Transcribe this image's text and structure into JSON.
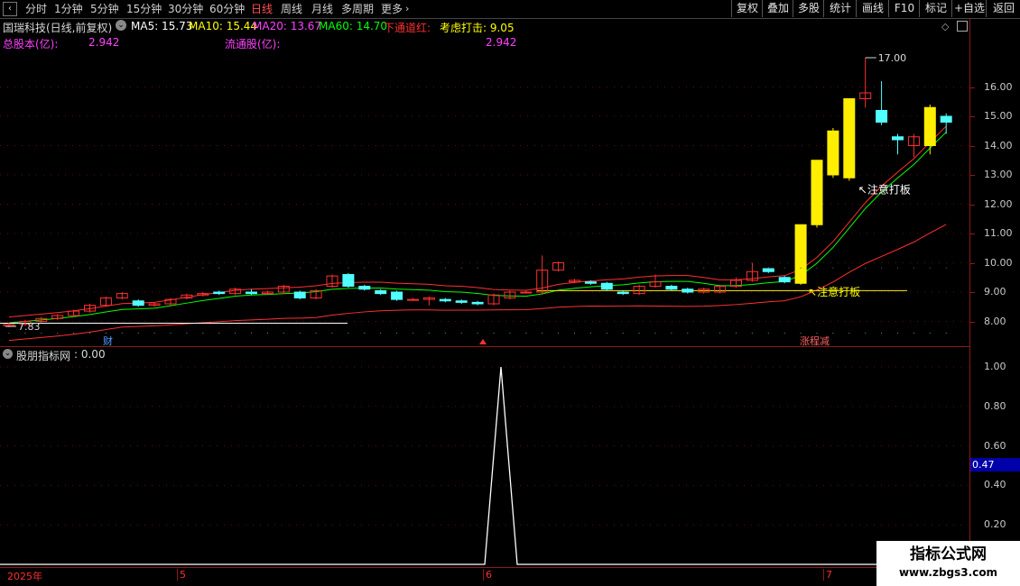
{
  "toolbar": {
    "back_icon": "chevron-left-icon",
    "periods": [
      "分时",
      "1分钟",
      "5分钟",
      "15分钟",
      "30分钟",
      "60分钟",
      "日线",
      "周线",
      "月线",
      "多周期",
      "更多"
    ],
    "active_period": "日线",
    "more_icon": "chevron-right-icon",
    "buttons": [
      "复权",
      "叠加",
      "多股",
      "统计",
      "画线",
      "F10",
      "标记",
      "+自选",
      "返回"
    ]
  },
  "header": {
    "stock": "国瑞科技(日线,前复权)",
    "ma5": "MA5: 15.73",
    "ma10": "MA10: 15.44",
    "ma20": "MA20: 13.67",
    "ma60": "MA60: 14.70",
    "signal1": "下通道红:",
    "signal2": "考虑打击: 9.05",
    "total_shares_label": "总股本(亿):",
    "total_shares": "2.942",
    "float_shares_label": "流通股(亿):",
    "float_shares": "2.942"
  },
  "chart_data": {
    "type": "candlestick",
    "y_ticks": [
      "16.00",
      "15.00",
      "14.00",
      "13.00",
      "12.00",
      "11.00",
      "10.00",
      "9.00",
      "8.00"
    ],
    "ylim": [
      7.4,
      17.4
    ],
    "high_label": "17.00",
    "low_label": "7.83",
    "annotations": [
      "注意打板",
      "注意打板"
    ],
    "markers": [
      "财",
      "涨程减"
    ],
    "hline": 9.05,
    "candles": [
      [
        7.85,
        7.9,
        7.8,
        7.95
      ],
      [
        7.9,
        8.0,
        7.85,
        8.05
      ],
      [
        8.0,
        8.1,
        7.95,
        8.15
      ],
      [
        8.1,
        8.2,
        8.05,
        8.25
      ],
      [
        8.2,
        8.35,
        8.15,
        8.4
      ],
      [
        8.35,
        8.55,
        8.3,
        8.6
      ],
      [
        8.55,
        8.8,
        8.5,
        8.85
      ],
      [
        8.8,
        8.95,
        8.75,
        9.0
      ],
      [
        8.7,
        8.55,
        8.5,
        8.75
      ],
      [
        8.55,
        8.6,
        8.5,
        8.65
      ],
      [
        8.6,
        8.75,
        8.55,
        8.8
      ],
      [
        8.8,
        8.9,
        8.75,
        8.95
      ],
      [
        8.9,
        8.95,
        8.85,
        9.0
      ],
      [
        9.0,
        8.95,
        8.9,
        9.05
      ],
      [
        8.95,
        9.1,
        8.9,
        9.15
      ],
      [
        9.0,
        8.95,
        8.9,
        9.1
      ],
      [
        8.95,
        9.0,
        8.9,
        9.05
      ],
      [
        9.0,
        9.2,
        8.95,
        9.25
      ],
      [
        9.0,
        8.8,
        8.75,
        9.05
      ],
      [
        8.8,
        9.05,
        8.75,
        9.1
      ],
      [
        9.2,
        9.55,
        9.15,
        9.6
      ],
      [
        9.6,
        9.2,
        9.15,
        9.65
      ],
      [
        9.2,
        9.1,
        9.05,
        9.25
      ],
      [
        9.05,
        8.95,
        8.9,
        9.1
      ],
      [
        9.0,
        8.75,
        8.7,
        9.05
      ],
      [
        8.75,
        8.75,
        8.7,
        8.8
      ],
      [
        8.75,
        8.8,
        8.55,
        8.85
      ],
      [
        8.75,
        8.7,
        8.65,
        8.8
      ],
      [
        8.7,
        8.65,
        8.6,
        8.75
      ],
      [
        8.65,
        8.6,
        8.55,
        8.7
      ],
      [
        8.6,
        8.9,
        8.55,
        8.95
      ],
      [
        8.8,
        9.0,
        8.75,
        9.05
      ],
      [
        9.0,
        9.0,
        8.95,
        9.05
      ],
      [
        9.0,
        9.75,
        8.95,
        10.25
      ],
      [
        9.75,
        10.0,
        9.7,
        10.05
      ],
      [
        9.35,
        9.4,
        9.3,
        9.45
      ],
      [
        9.35,
        9.3,
        9.25,
        9.4
      ],
      [
        9.3,
        9.1,
        9.05,
        9.35
      ],
      [
        9.0,
        8.95,
        8.9,
        9.05
      ],
      [
        8.95,
        9.2,
        8.9,
        9.25
      ],
      [
        9.2,
        9.35,
        9.15,
        9.6
      ],
      [
        9.2,
        9.1,
        9.05,
        9.25
      ],
      [
        9.1,
        9.0,
        8.95,
        9.15
      ],
      [
        9.0,
        9.1,
        8.95,
        9.15
      ],
      [
        9.0,
        9.2,
        8.95,
        9.25
      ],
      [
        9.2,
        9.4,
        9.15,
        9.5
      ],
      [
        9.4,
        9.7,
        9.35,
        10.0
      ],
      [
        9.8,
        9.7,
        9.65,
        9.85
      ],
      [
        9.5,
        9.35,
        9.3,
        9.55
      ],
      [
        9.3,
        11.3,
        9.25,
        11.3
      ],
      [
        11.3,
        13.5,
        11.2,
        13.5
      ],
      [
        13.0,
        14.5,
        12.9,
        14.6
      ],
      [
        12.9,
        15.6,
        12.8,
        15.6
      ],
      [
        15.6,
        15.8,
        15.3,
        17.0
      ],
      [
        15.2,
        14.8,
        14.7,
        16.2
      ],
      [
        14.3,
        14.2,
        13.7,
        14.4
      ],
      [
        14.0,
        14.3,
        13.6,
        14.4
      ],
      [
        14.0,
        15.3,
        13.7,
        15.4
      ],
      [
        15.0,
        14.8,
        14.4,
        15.1
      ]
    ]
  },
  "indicator": {
    "title": "股朋指标网",
    "value": ": 0.00",
    "y_ticks": [
      "1.00",
      "0.80",
      "0.60",
      "0.40",
      "0.20"
    ],
    "cursor_value": "0.47"
  },
  "time_axis": {
    "labels": [
      "2025年",
      "5",
      "6",
      "7"
    ]
  },
  "watermark": {
    "title": "指标公式网",
    "url": "www.zbgs3.com"
  },
  "colors": {
    "up": "#ff3030",
    "down": "#50ffff",
    "limit_up": "#ffee00",
    "ma5": "#ffffff",
    "ma10": "#ffff00",
    "ma20": "#ff40ff",
    "ma60": "#00ff00"
  }
}
